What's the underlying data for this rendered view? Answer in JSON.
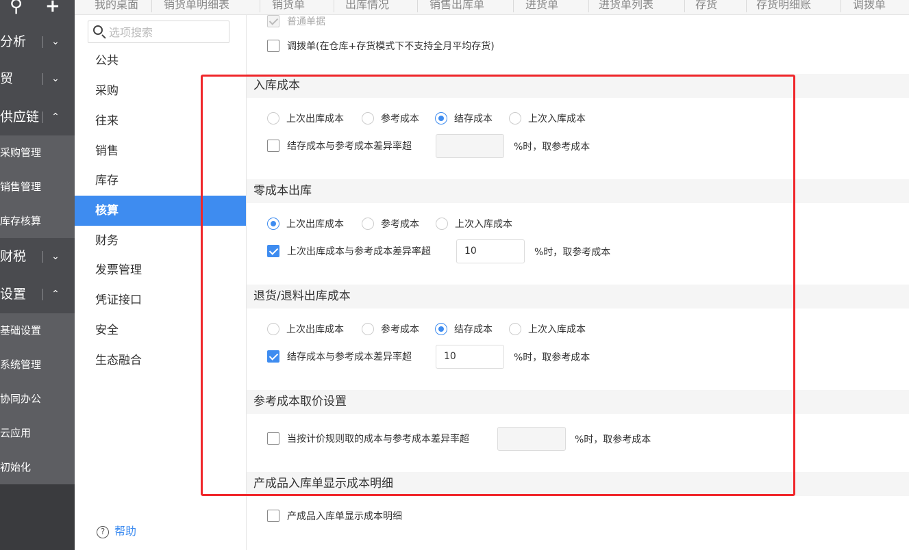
{
  "leftnav": {
    "top_icons": [
      "search-icon",
      "plus-icon"
    ],
    "groups": [
      {
        "label": "分析",
        "chevron": "chevron-down-icon"
      },
      {
        "label": "贸",
        "chevron": "chevron-down-icon"
      },
      {
        "label": "供应链",
        "chevron": "chevron-up-icon"
      },
      {
        "label": "财税",
        "chevron": "chevron-down-icon"
      },
      {
        "label": "设置",
        "chevron": "chevron-up-icon"
      }
    ],
    "supply_items": [
      "采购管理",
      "销售管理",
      "库存核算"
    ],
    "settings_items": [
      "基础设置",
      "系统管理",
      "协同办公",
      "云应用",
      "初始化"
    ]
  },
  "tabs": [
    "我的桌面",
    "销货单明细表",
    "销货单",
    "出库情况",
    "销售出库单",
    "进货单",
    "进货单列表",
    "存货",
    "存货明细账",
    "调拨单"
  ],
  "categories": {
    "search_placeholder": "选项搜索",
    "items": [
      "公共",
      "采购",
      "往来",
      "销售",
      "库存",
      "核算",
      "财务",
      "发票管理",
      "凭证接口",
      "安全",
      "生态融合"
    ],
    "active": "核算",
    "help_label": "帮助"
  },
  "content": {
    "top_items": {
      "normal_doc": "普通单据",
      "transfer_doc": "调拨单(在仓库+存货模式下不支持全月平均存货)"
    },
    "sections": {
      "inbound_cost": {
        "title": "入库成本",
        "options": [
          "上次出库成本",
          "参考成本",
          "结存成本",
          "上次入库成本"
        ],
        "selected": "结存成本",
        "check_label": "结存成本与参考成本差异率超",
        "check_checked": false,
        "value": "",
        "suffix": "%时，取参考成本"
      },
      "zero_cost": {
        "title": "零成本出库",
        "options": [
          "上次出库成本",
          "参考成本",
          "上次入库成本"
        ],
        "selected": "上次出库成本",
        "check_label": "上次出库成本与参考成本差异率超",
        "check_checked": true,
        "value": "10",
        "suffix": "%时，取参考成本"
      },
      "return_cost": {
        "title": "退货/退料出库成本",
        "options": [
          "上次出库成本",
          "参考成本",
          "结存成本",
          "上次入库成本"
        ],
        "selected": "结存成本",
        "check_label": "结存成本与参考成本差异率超",
        "check_checked": true,
        "value": "10",
        "suffix": "%时，取参考成本"
      },
      "ref_price": {
        "title": "参考成本取价设置",
        "check_label": "当按计价规则取的成本与参考成本差异率超",
        "check_checked": false,
        "value": "",
        "suffix": "%时，取参考成本"
      },
      "product_detail": {
        "title": "产成品入库单显示成本明细",
        "check_label": "产成品入库单显示成本明细",
        "check_checked": false
      }
    }
  },
  "colors": {
    "accent": "#3e8cf0",
    "highlight_box": "#f0262a",
    "nav_dark": "#4a4b4f"
  }
}
